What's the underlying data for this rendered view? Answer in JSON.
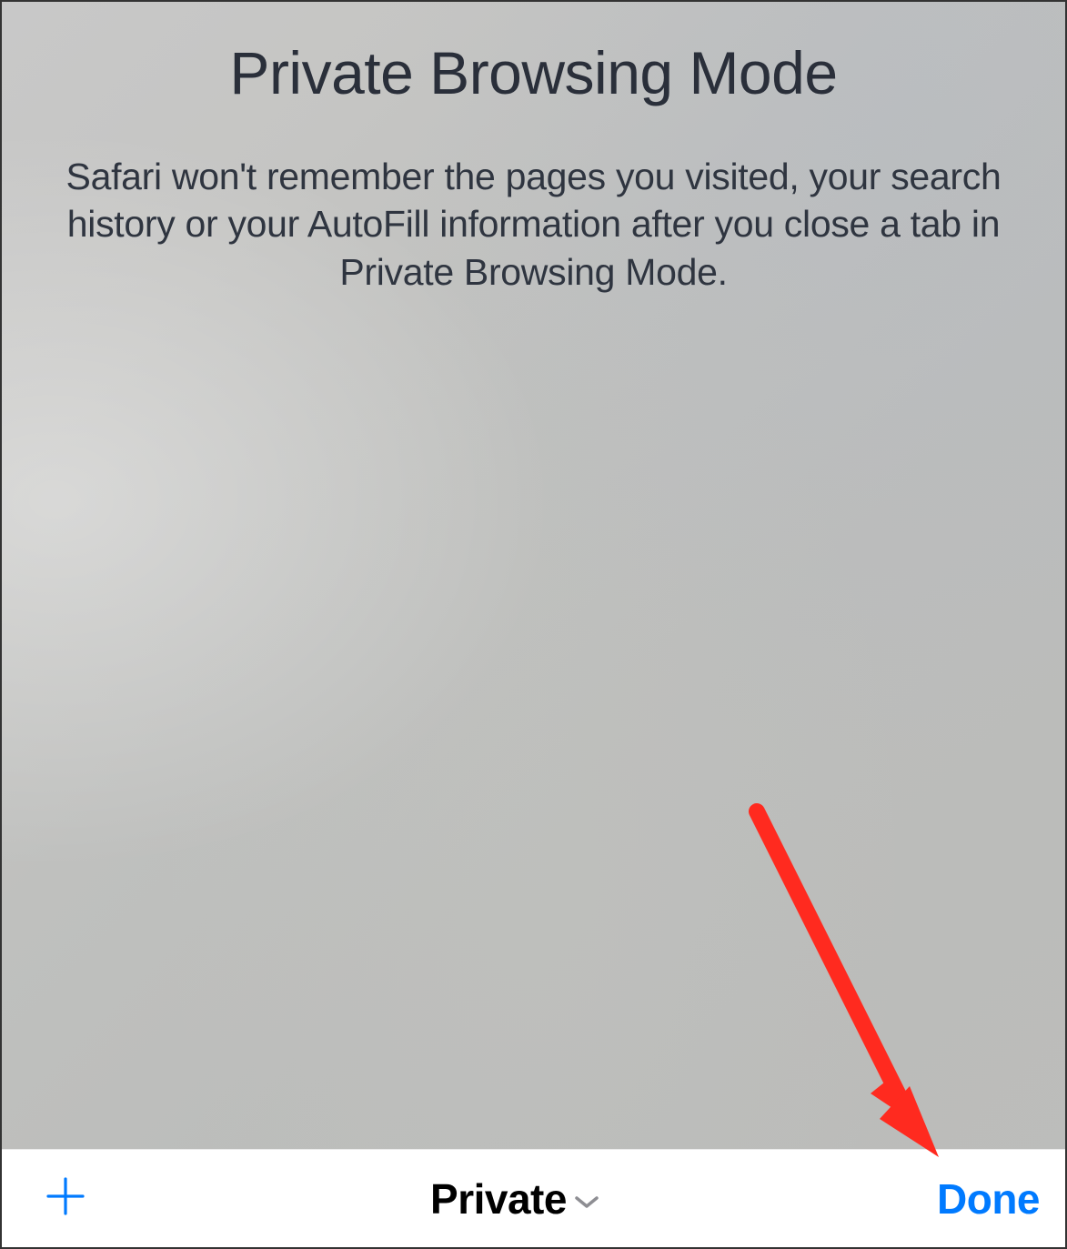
{
  "main": {
    "title": "Private Browsing Mode",
    "description": "Safari won't remember the pages you visited, your search history or your AutoFill information after you close a tab in Private Browsing Mode."
  },
  "toolbar": {
    "tab_label": "Private",
    "done_label": "Done"
  },
  "colors": {
    "accent": "#007AFF",
    "annotation": "#FF2A1F"
  }
}
